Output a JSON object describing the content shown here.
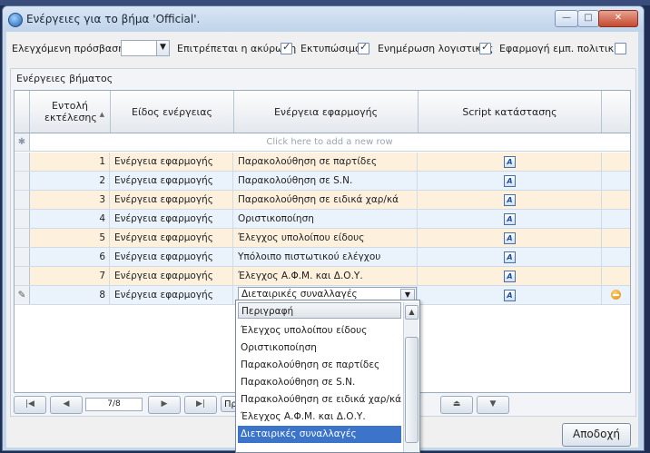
{
  "window": {
    "title": "Ενέργειες για το βήμα 'Official'."
  },
  "options": {
    "controlled_access_label": "Ελεγχόμενη πρόσβαση",
    "controlled_access_value": "",
    "items": [
      {
        "label": "Επιτρέπεται η ακύρωση",
        "checked": true
      },
      {
        "label": "Εκτυπώσιμο",
        "checked": true
      },
      {
        "label": "Ενημέρωση λογιστικής",
        "checked": true
      },
      {
        "label": "Εφαρμογή εμπ. πολιτικής",
        "checked": false
      }
    ]
  },
  "group": {
    "caption": "Ενέργειες βήματος"
  },
  "grid": {
    "columns": [
      "Εντολή εκτέλεσης",
      "Είδος ενέργειας",
      "Ενέργεια εφαρμογής",
      "Script κατάστασης"
    ],
    "new_row_text": "Click here to add a new row",
    "rows": [
      {
        "order": "1",
        "type": "Ενέργεια εφαρμογής",
        "action": "Παρακολούθηση σε παρτίδες"
      },
      {
        "order": "2",
        "type": "Ενέργεια εφαρμογής",
        "action": "Παρακολούθηση σε S.N."
      },
      {
        "order": "3",
        "type": "Ενέργεια εφαρμογής",
        "action": "Παρακολούθηση σε ειδικά χαρ/κά"
      },
      {
        "order": "4",
        "type": "Ενέργεια εφαρμογής",
        "action": "Οριστικοποίηση"
      },
      {
        "order": "5",
        "type": "Ενέργεια εφαρμογής",
        "action": "Έλεγχος υπολοίπου είδους"
      },
      {
        "order": "6",
        "type": "Ενέργεια εφαρμογής",
        "action": "Υπόλοιπο πιστωτικού ελέγχου"
      },
      {
        "order": "7",
        "type": "Ενέργεια εφαρμογής",
        "action": "Έλεγχος Α.Φ.Μ. και Δ.Ο.Υ."
      },
      {
        "order": "8",
        "type": "Ενέργεια εφαρμογής",
        "action": "Διεταιρικές συναλλαγές"
      }
    ],
    "script_icon_glyph": "A"
  },
  "dropdown": {
    "header": "Περιγραφή",
    "items": [
      "Έλεγχος υπολοίπου είδους",
      "Οριστικοποίηση",
      "Παρακολούθηση σε παρτίδες",
      "Παρακολούθηση σε S.N.",
      "Παρακολούθηση σε ειδικά χαρ/κά",
      "Έλεγχος Α.Φ.Μ. και Δ.Ο.Υ.",
      "Διεταιρικές συναλλαγές"
    ],
    "selected_index": 6
  },
  "navigator": {
    "page_info": "7/8",
    "partial_label": "Πρ"
  },
  "buttons": {
    "ok_label": "Αποδοχή"
  }
}
